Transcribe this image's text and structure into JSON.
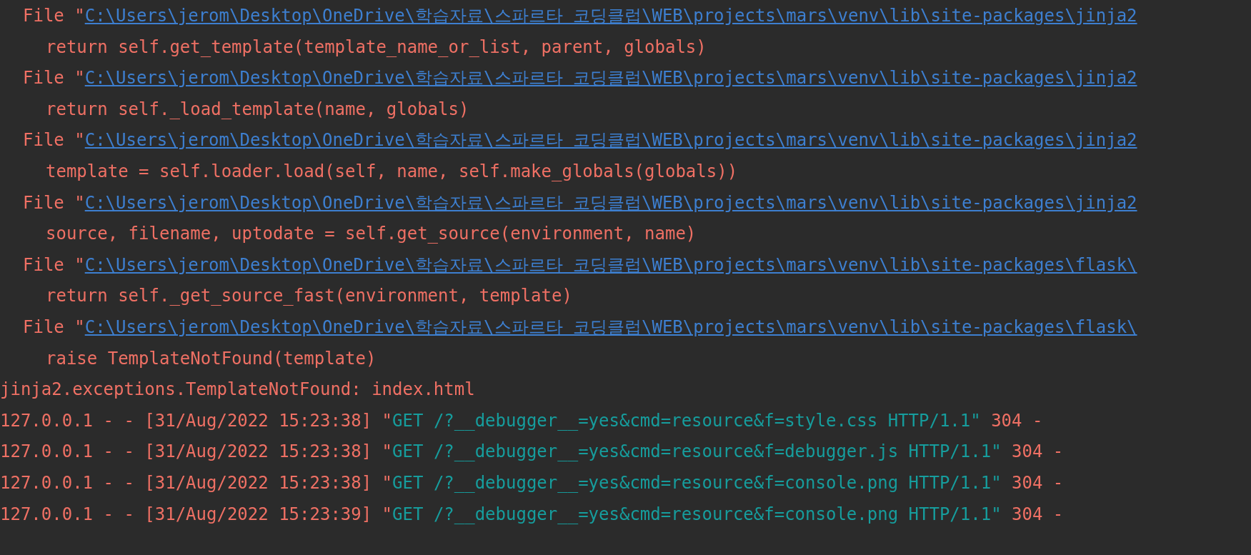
{
  "console": {
    "lines": [
      {
        "kind": "frame",
        "label": "File \"",
        "link": "C:\\Users\\jerom\\Desktop\\OneDrive\\학습자료\\스파르타 코딩클럽\\WEB\\projects\\mars\\venv\\lib\\site-packages\\jinja2"
      },
      {
        "kind": "code",
        "text": "return self.get_template(template_name_or_list, parent, globals)"
      },
      {
        "kind": "frame",
        "label": "File \"",
        "link": "C:\\Users\\jerom\\Desktop\\OneDrive\\학습자료\\스파르타 코딩클럽\\WEB\\projects\\mars\\venv\\lib\\site-packages\\jinja2"
      },
      {
        "kind": "code",
        "text": "return self._load_template(name, globals)"
      },
      {
        "kind": "frame",
        "label": "File \"",
        "link": "C:\\Users\\jerom\\Desktop\\OneDrive\\학습자료\\스파르타 코딩클럽\\WEB\\projects\\mars\\venv\\lib\\site-packages\\jinja2"
      },
      {
        "kind": "code",
        "text": "template = self.loader.load(self, name, self.make_globals(globals))"
      },
      {
        "kind": "frame",
        "label": "File \"",
        "link": "C:\\Users\\jerom\\Desktop\\OneDrive\\학습자료\\스파르타 코딩클럽\\WEB\\projects\\mars\\venv\\lib\\site-packages\\jinja2"
      },
      {
        "kind": "code",
        "text": "source, filename, uptodate = self.get_source(environment, name)"
      },
      {
        "kind": "frame",
        "label": "File \"",
        "link": "C:\\Users\\jerom\\Desktop\\OneDrive\\학습자료\\스파르타 코딩클럽\\WEB\\projects\\mars\\venv\\lib\\site-packages\\flask\\"
      },
      {
        "kind": "code",
        "text": "return self._get_source_fast(environment, template)"
      },
      {
        "kind": "frame",
        "label": "File \"",
        "link": "C:\\Users\\jerom\\Desktop\\OneDrive\\학습자료\\스파르타 코딩클럽\\WEB\\projects\\mars\\venv\\lib\\site-packages\\flask\\"
      },
      {
        "kind": "code",
        "text": "raise TemplateNotFound(template)"
      },
      {
        "kind": "error",
        "text": "jinja2.exceptions.TemplateNotFound: index.html"
      },
      {
        "kind": "request",
        "prefix": "127.0.0.1 - - [31/Aug/2022 15:23:38] \"",
        "request": "GET /?__debugger__=yes&cmd=resource&f=style.css HTTP/1.1\"",
        "status": "304 -"
      },
      {
        "kind": "request",
        "prefix": "127.0.0.1 - - [31/Aug/2022 15:23:38] \"",
        "request": "GET /?__debugger__=yes&cmd=resource&f=debugger.js HTTP/1.1\"",
        "status": "304 -"
      },
      {
        "kind": "request",
        "prefix": "127.0.0.1 - - [31/Aug/2022 15:23:38] \"",
        "request": "GET /?__debugger__=yes&cmd=resource&f=console.png HTTP/1.1\"",
        "status": "304 -"
      },
      {
        "kind": "request",
        "prefix": "127.0.0.1 - - [31/Aug/2022 15:23:39] \"",
        "request": "GET /?__debugger__=yes&cmd=resource&f=console.png HTTP/1.1\"",
        "status": "304 -"
      }
    ]
  }
}
